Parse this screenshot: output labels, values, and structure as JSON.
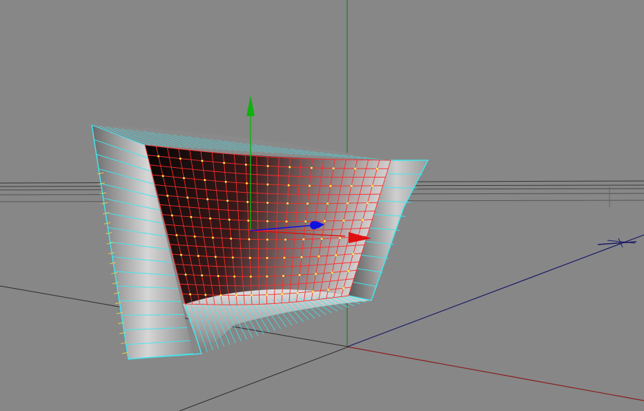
{
  "viewport": {
    "view_name": "perspective",
    "background_color": "#878787",
    "text_labels": []
  },
  "scene": {
    "ground_grid": {
      "visible": true,
      "color": "#2a2a2a"
    },
    "world_axes": {
      "x_axis_color": "#8a1a1a",
      "y_axis_color": "#1e7a1e",
      "z_axis_color": "#1a1a6a"
    },
    "object": {
      "type": "nurbs-surface",
      "selected": true,
      "isoparm_color": "#ff2a2a",
      "cv_color": "#ffff40",
      "wireframe_color": "#40e6f0",
      "normal_color": "#e6d24a"
    },
    "move_manipulator": {
      "x_handle_color": "#e01010",
      "y_handle_color": "#10b010",
      "z_handle_color": "#1010e0",
      "center_color": "#1010e0"
    },
    "orientation_icon": "view-compass-icon"
  }
}
